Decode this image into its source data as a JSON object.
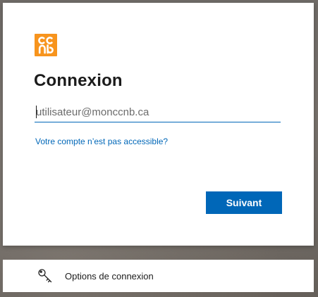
{
  "brand": {
    "logo_name": "ccnb",
    "logo_color": "#f7941d"
  },
  "signin": {
    "title": "Connexion",
    "email_placeholder": "utilisateur@monccnb.ca",
    "email_value": "",
    "cant_access_link": "Votre compte n’est pas accessible?",
    "next_button": "Suivant"
  },
  "options": {
    "label": "Options de connexion",
    "icon": "key-icon"
  },
  "colors": {
    "accent": "#0067b8",
    "text": "#1b1b1b"
  }
}
